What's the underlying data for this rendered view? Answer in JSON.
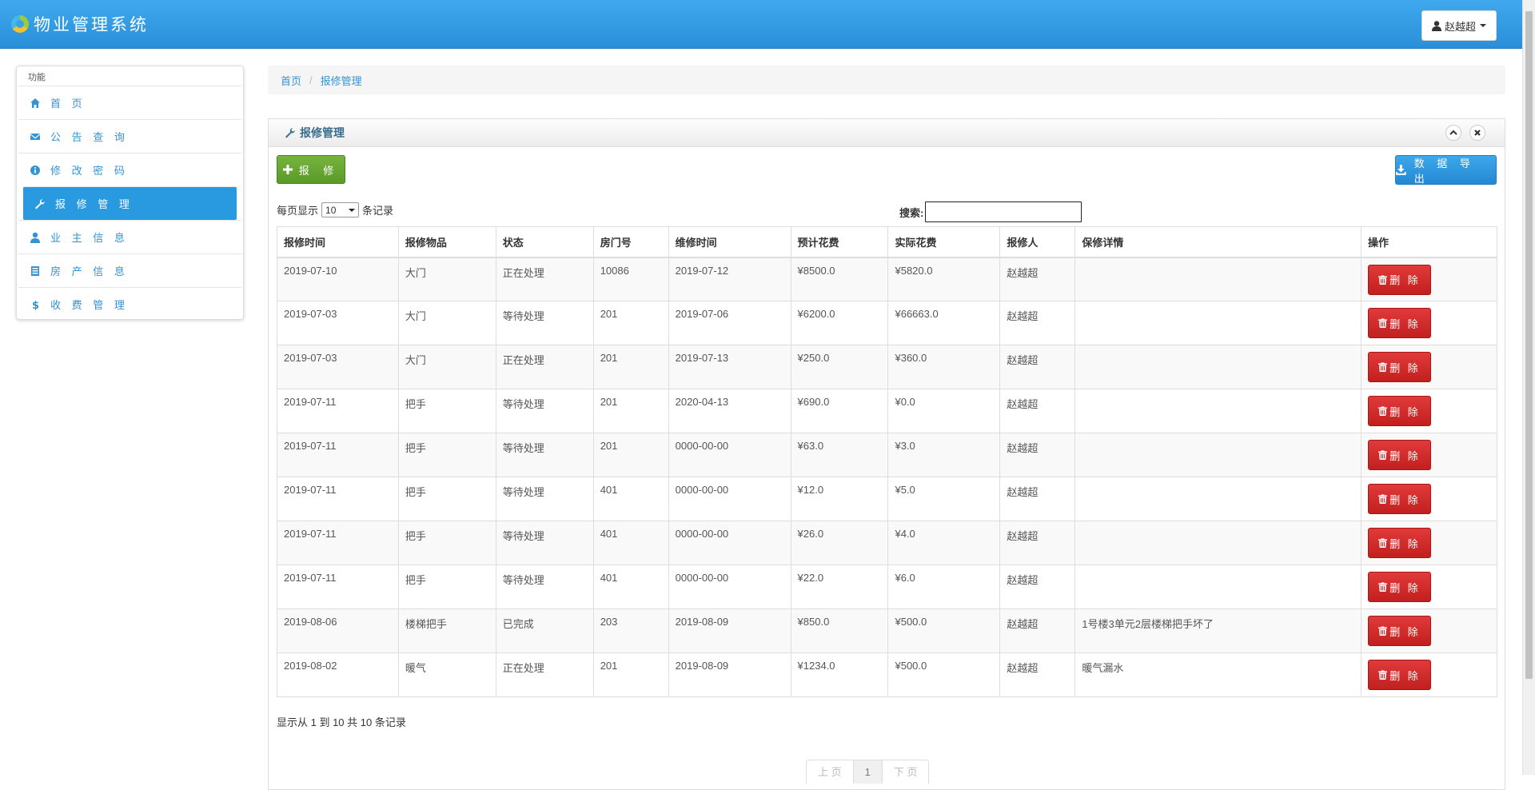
{
  "header": {
    "title": "物业管理系统",
    "user": "赵越超"
  },
  "sidebar": {
    "heading": "功能",
    "items": [
      {
        "label": "首 页",
        "icon": "home-icon"
      },
      {
        "label": "公 告 查 询",
        "icon": "envelope-icon"
      },
      {
        "label": "修 改 密 码",
        "icon": "info-circle-icon"
      },
      {
        "label": "报 修 管 理",
        "icon": "wrench-icon",
        "active": true
      },
      {
        "label": "业 主 信 息",
        "icon": "user-icon"
      },
      {
        "label": "房 产 信 息",
        "icon": "list-icon"
      },
      {
        "label": "收 费 管 理",
        "icon": "dollar-icon"
      }
    ]
  },
  "breadcrumb": {
    "home": "首页",
    "current": "报修管理"
  },
  "panel": {
    "title": "报修管理",
    "add_button": "报 修",
    "export_button": "数 据 导 出"
  },
  "table_controls": {
    "length_prefix": "每页显示",
    "length_value": "10",
    "length_suffix": "条记录",
    "search_label": "搜索:"
  },
  "table": {
    "headers": [
      "报修时间",
      "报修物品",
      "状态",
      "房门号",
      "维修时间",
      "预计花费",
      "实际花费",
      "报修人",
      "保修详情",
      "操作"
    ],
    "delete_label": "删 除",
    "rows": [
      [
        "2019-07-10",
        "大门",
        "正在处理",
        "10086",
        "2019-07-12",
        "¥8500.0",
        "¥5820.0",
        "赵越超",
        ""
      ],
      [
        "2019-07-03",
        "大门",
        "等待处理",
        "201",
        "2019-07-06",
        "¥6200.0",
        "¥66663.0",
        "赵越超",
        ""
      ],
      [
        "2019-07-03",
        "大门",
        "正在处理",
        "201",
        "2019-07-13",
        "¥250.0",
        "¥360.0",
        "赵越超",
        ""
      ],
      [
        "2019-07-11",
        "把手",
        "等待处理",
        "201",
        "2020-04-13",
        "¥690.0",
        "¥0.0",
        "赵越超",
        ""
      ],
      [
        "2019-07-11",
        "把手",
        "等待处理",
        "201",
        "0000-00-00",
        "¥63.0",
        "¥3.0",
        "赵越超",
        ""
      ],
      [
        "2019-07-11",
        "把手",
        "等待处理",
        "401",
        "0000-00-00",
        "¥12.0",
        "¥5.0",
        "赵越超",
        ""
      ],
      [
        "2019-07-11",
        "把手",
        "等待处理",
        "401",
        "0000-00-00",
        "¥26.0",
        "¥4.0",
        "赵越超",
        ""
      ],
      [
        "2019-07-11",
        "把手",
        "等待处理",
        "401",
        "0000-00-00",
        "¥22.0",
        "¥6.0",
        "赵越超",
        ""
      ],
      [
        "2019-08-06",
        "楼梯把手",
        "已完成",
        "203",
        "2019-08-09",
        "¥850.0",
        "¥500.0",
        "赵越超",
        "1号楼3单元2层楼梯把手坏了"
      ],
      [
        "2019-08-02",
        "暖气",
        "正在处理",
        "201",
        "2019-08-09",
        "¥1234.0",
        "¥500.0",
        "赵越超",
        "暖气漏水"
      ]
    ]
  },
  "footer": {
    "info": "显示从 1 到 10 共 10 条记录",
    "pager": [
      "上 页",
      "1",
      "下 页"
    ]
  },
  "colors": {
    "brand": "#2a9ae0",
    "success": "#5a9a29",
    "danger": "#c41f1f"
  }
}
